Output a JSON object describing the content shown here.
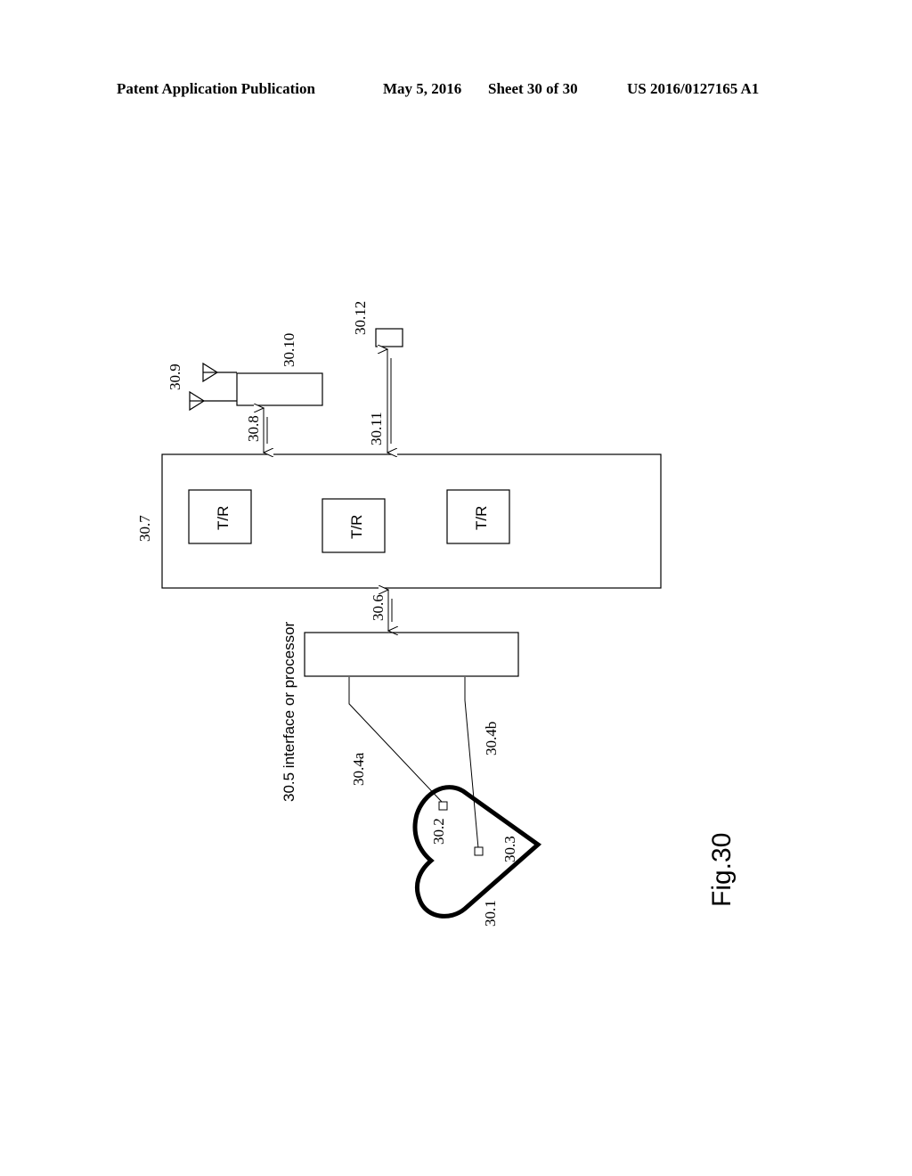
{
  "header": {
    "publication": "Patent Application Publication",
    "date": "May 5, 2016",
    "sheet": "Sheet 30 of 30",
    "patent_number": "US 2016/0127165 A1"
  },
  "figure": {
    "caption": "Fig.30",
    "labels": {
      "heart": "30.1",
      "electrode_a": "30.2",
      "electrode_b": "30.3",
      "lead_a": "30.4a",
      "lead_b": "30.4b",
      "interface": "30.5 interface or processor",
      "link_interface": "30.6",
      "transceiver_unit": "30.7",
      "link_radio": "30.8",
      "antennas": "30.9",
      "radio_module": "30.10",
      "link_external": "30.11",
      "external_device": "30.12"
    },
    "transceivers": [
      "T/R",
      "T/R",
      "T/R"
    ]
  }
}
